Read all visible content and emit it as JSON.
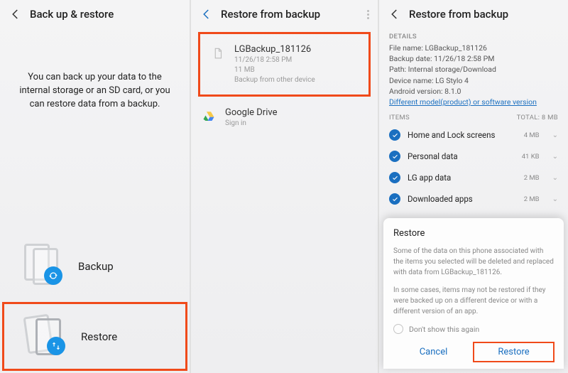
{
  "pane1": {
    "title": "Back up & restore",
    "intro": "You can back up your data to the internal storage or an SD card, or you can restore data from a backup.",
    "backup_label": "Backup",
    "restore_label": "Restore"
  },
  "pane2": {
    "title": "Restore from backup",
    "backup_item": {
      "name": "LGBackup_181126",
      "date": "11/26/18 2:58 PM",
      "size": "11 MB",
      "note": "Backup from other device"
    },
    "gdrive": {
      "name": "Google Drive",
      "sub": "Sign in"
    }
  },
  "pane3": {
    "title": "Restore from backup",
    "details_hdr": "DETAILS",
    "file_name": "File name: LGBackup_181126",
    "backup_date": "Backup date: 11/26/18 2:58 PM",
    "path": "Path: Internal storage/Download",
    "device_name": "Device name: LG Stylo 4",
    "android_ver": "Android version: 8.1.0",
    "diff_link": "Different model(product) or software version",
    "items_hdr": "ITEMS",
    "total": "TOTAL: 8 MB",
    "items": [
      {
        "name": "Home and Lock screens",
        "size": "4 MB"
      },
      {
        "name": "Personal data",
        "size": "41 KB"
      },
      {
        "name": "LG app data",
        "size": "2 MB"
      },
      {
        "name": "Downloaded apps",
        "size": "2 MB"
      }
    ],
    "sheet": {
      "title": "Restore",
      "p1": "Some of the data on this phone associated with the items you selected will be deleted and replaced with data from LGBackup_181126.",
      "p2": "In some cases, items may not be restored if they were backed up on a different device or with a different version of an app.",
      "dont": "Don't show this again",
      "cancel": "Cancel",
      "restore": "Restore"
    }
  }
}
